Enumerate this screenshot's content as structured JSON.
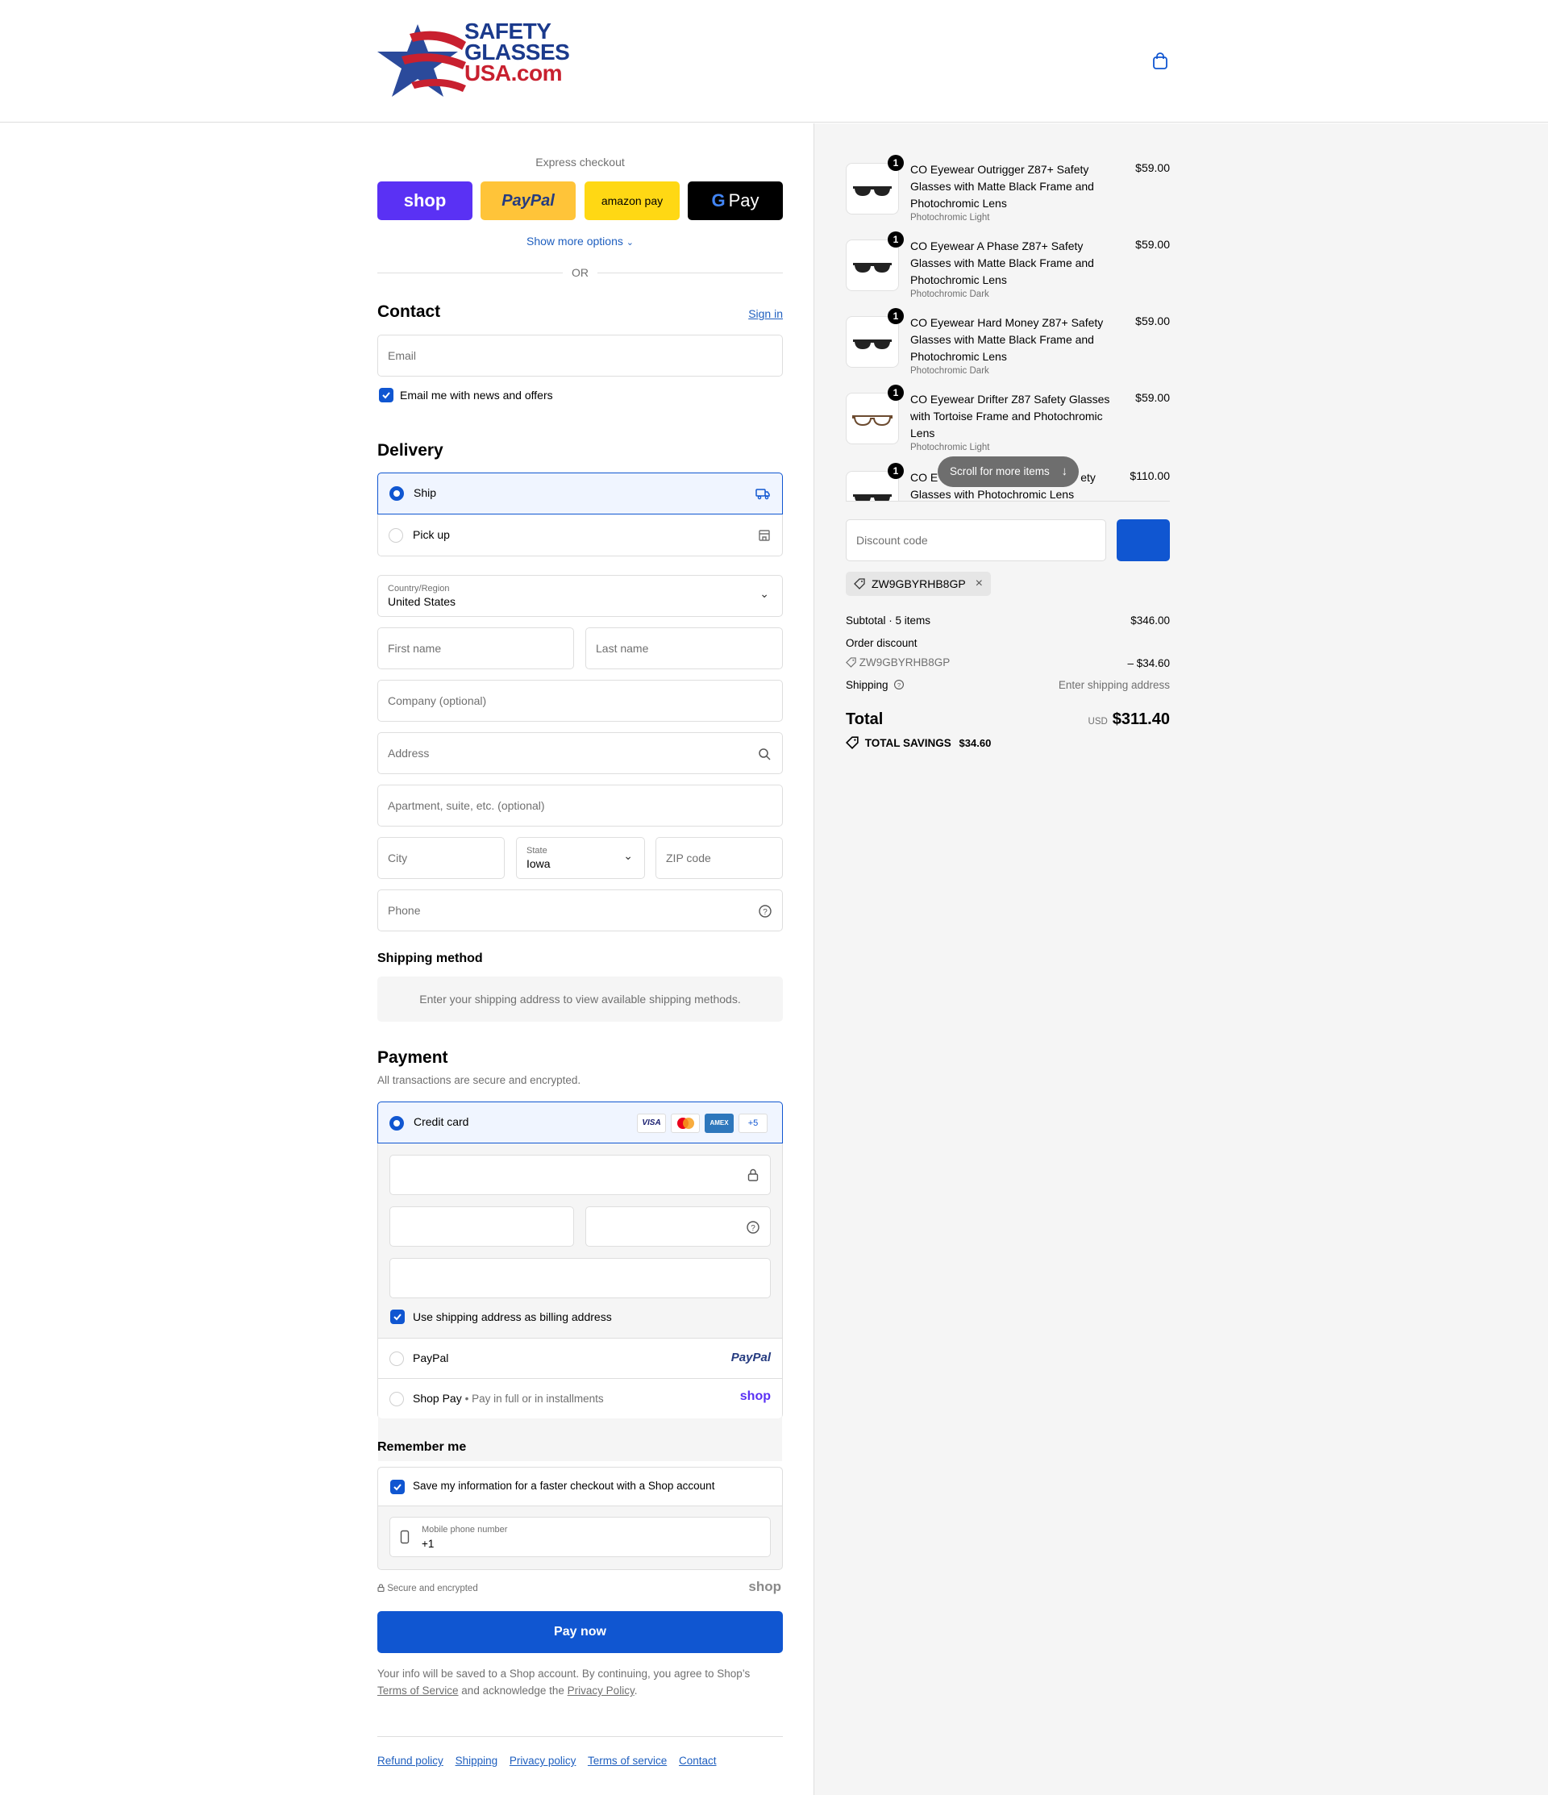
{
  "header": {
    "logo_line1": "SAFETY",
    "logo_line2": "GLASSES",
    "logo_line3": "USA.com",
    "cart_icon": "shopping-bag-icon"
  },
  "express": {
    "title": "Express checkout",
    "shop_label": "shop",
    "paypal_label": "PayPal",
    "amazon_label": "amazon pay",
    "gpay_label": "Pay",
    "show_more": "Show more options",
    "or": "OR"
  },
  "contact": {
    "title": "Contact",
    "sign_in": "Sign in",
    "email_placeholder": "Email",
    "news_label": "Email me with news and offers"
  },
  "delivery": {
    "title": "Delivery",
    "ship_label": "Ship",
    "pickup_label": "Pick up",
    "country_label": "Country/Region",
    "country_value": "United States",
    "first_name": "First name",
    "last_name": "Last name",
    "company": "Company (optional)",
    "address": "Address",
    "apartment": "Apartment, suite, etc. (optional)",
    "city": "City",
    "state_label": "State",
    "state_value": "Iowa",
    "zip": "ZIP code",
    "phone": "Phone"
  },
  "shipping_method": {
    "title": "Shipping method",
    "message": "Enter your shipping address to view available shipping methods."
  },
  "payment": {
    "title": "Payment",
    "subtitle": "All transactions are secure and encrypted.",
    "credit_card": "Credit card",
    "card_more": "+5",
    "visa": "VISA",
    "amex": "AMEX",
    "billing_label": "Use shipping address as billing address",
    "paypal": "PayPal",
    "paypal_logo": "PayPal",
    "shoppay": "Shop Pay",
    "shoppay_sub": "Pay in full or in installments",
    "shop_logo": "shop"
  },
  "remember": {
    "title": "Remember me",
    "save_label": "Save my information for a faster checkout with a Shop account",
    "mobile_label": "Mobile phone number",
    "mobile_value": "+1",
    "secure": "Secure and encrypted",
    "shop_logo": "shop"
  },
  "pay_now": "Pay now",
  "legal": {
    "text1": "Your info will be saved to a Shop account. By continuing, you agree to Shop’s",
    "terms": "Terms of Service",
    "text2": "and acknowledge the",
    "privacy": "Privacy Policy",
    "text3": "."
  },
  "footer": {
    "links": [
      "Refund policy",
      "Shipping",
      "Privacy policy",
      "Terms of service",
      "Contact"
    ]
  },
  "cart": {
    "items": [
      {
        "qty": "1",
        "name": "CO Eyewear Outrigger Z87+ Safety Glasses with Matte Black Frame and Photochromic Lens",
        "variant": "Photochromic Light",
        "price": "$59.00"
      },
      {
        "qty": "1",
        "name": "CO Eyewear A Phase Z87+ Safety Glasses with Matte Black Frame and Photochromic Lens",
        "variant": "Photochromic Dark",
        "price": "$59.00"
      },
      {
        "qty": "1",
        "name": "CO Eyewear Hard Money Z87+ Safety Glasses with Matte Black Frame and Photochromic Lens",
        "variant": "Photochromic Dark",
        "price": "$59.00"
      },
      {
        "qty": "1",
        "name": "CO Eyewear Drifter Z87 Safety Glasses with Tortoise Frame and Photochromic Lens",
        "variant": "Photochromic Light",
        "price": "$59.00"
      },
      {
        "qty": "1",
        "name": "CO Eyewear ... Safety Glasses with Photochromic Lens",
        "variant": "",
        "price": "$110.00"
      }
    ],
    "item5_name_left": "CO E",
    "item5_name_right": "ety",
    "item5_line2": "Glasses with Photochromic Lens",
    "scroll_hint": "Scroll for more items",
    "discount_placeholder": "Discount code",
    "applied_code": "ZW9GBYRHB8GP",
    "subtotal_label": "Subtotal · 5 items",
    "subtotal_value": "$346.00",
    "order_discount_label": "Order discount",
    "discount_code": "ZW9GBYRHB8GP",
    "discount_value": "– $34.60",
    "shipping_label": "Shipping",
    "shipping_value": "Enter shipping address",
    "total_label": "Total",
    "currency": "USD",
    "total_value": "$311.40",
    "savings_label": "TOTAL SAVINGS",
    "savings_value": "$34.60"
  },
  "colors": {
    "accent": "#1056d1",
    "shop_purple": "#5a31f4",
    "paypal_yellow": "#ffc439",
    "amazon_yellow": "#ffd814"
  }
}
